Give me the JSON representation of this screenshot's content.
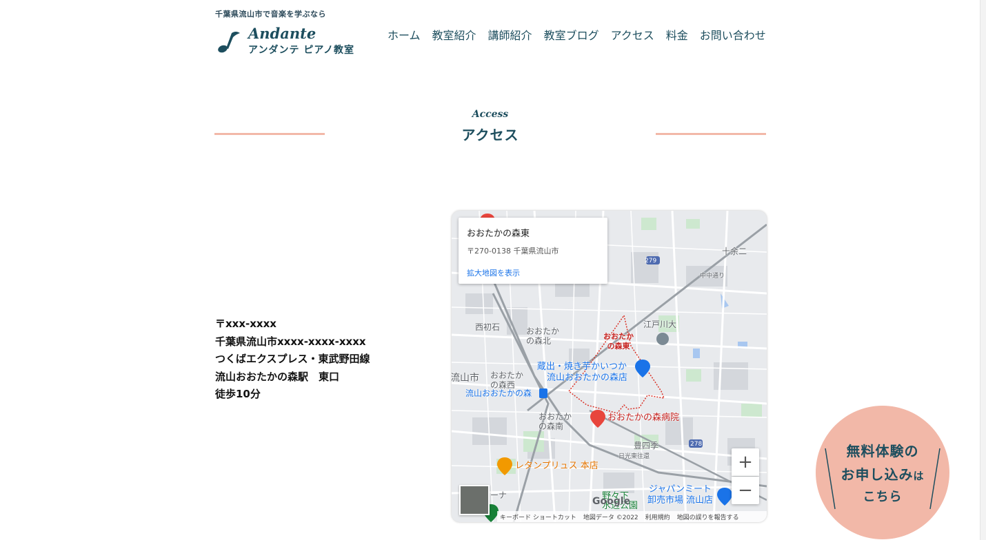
{
  "header": {
    "tagline": "千葉県流山市で音楽を学ぶなら",
    "logo_en": "Andante",
    "logo_ja": "アンダンテ ピアノ教室",
    "nav": [
      "ホーム",
      "教室紹介",
      "講師紹介",
      "教室ブログ",
      "アクセス",
      "料金",
      "お問い合わせ"
    ]
  },
  "section": {
    "title_en": "Access",
    "title_ja": "アクセス"
  },
  "address": {
    "postal": "〒xxx-xxxx",
    "street": "千葉県流山市xxxx-xxxx-xxxx",
    "line": "つくばエクスプレス・東武野田線",
    "station": "流山おおたかの森駅　東口",
    "walk": "徒歩10分"
  },
  "map": {
    "card_title": "おおたかの森東",
    "card_address": "〒270-0138 千葉県流山市",
    "card_link": "拡大地図を表示",
    "labels": {
      "jyuuyoni": "十余二",
      "nishi_hatsuishi": "西初石",
      "otaka_kita": "おおたか\nの森北",
      "otaka_higashi": "おおたか\nの森東",
      "edogawa": "江戸川大",
      "kurade": "蔵出・焼き芋かいつか",
      "kurade2": "流山おおたかの森店",
      "nagareyama_city": "流山市",
      "otaka_nishi": "おおたか\nの森西",
      "station": "流山おおたかの森",
      "otaka_minami": "おおたか\nの森南",
      "hospital": "おおたかの森病院",
      "toyoshiki": "豊四季",
      "nikko": "日光東往還",
      "restaurant": "レタンプリュス 本店",
      "japan_meat": "ジャパンミート",
      "japan_meat2": "卸売市場 流山店",
      "noda": "野々下",
      "nagareyama_park": "水辺公園",
      "kouchi": "ーナ",
      "route279": "279",
      "route278": "278",
      "nakadoori": "中中通り"
    },
    "zoom_in": "+",
    "zoom_out": "−",
    "google": "Google",
    "attribution": [
      "キーボード ショートカット",
      "地図データ ©2022",
      "利用規約",
      "地図の誤りを報告する"
    ]
  },
  "cta": {
    "line1": "無料体験の",
    "line2a": "お申し込み",
    "line2b": "は",
    "line3": "こちら"
  },
  "colors": {
    "brand": "#1d4e5e",
    "accent": "#f2b8a8",
    "map_link": "#1a73e8",
    "area_border": "#d93025"
  }
}
